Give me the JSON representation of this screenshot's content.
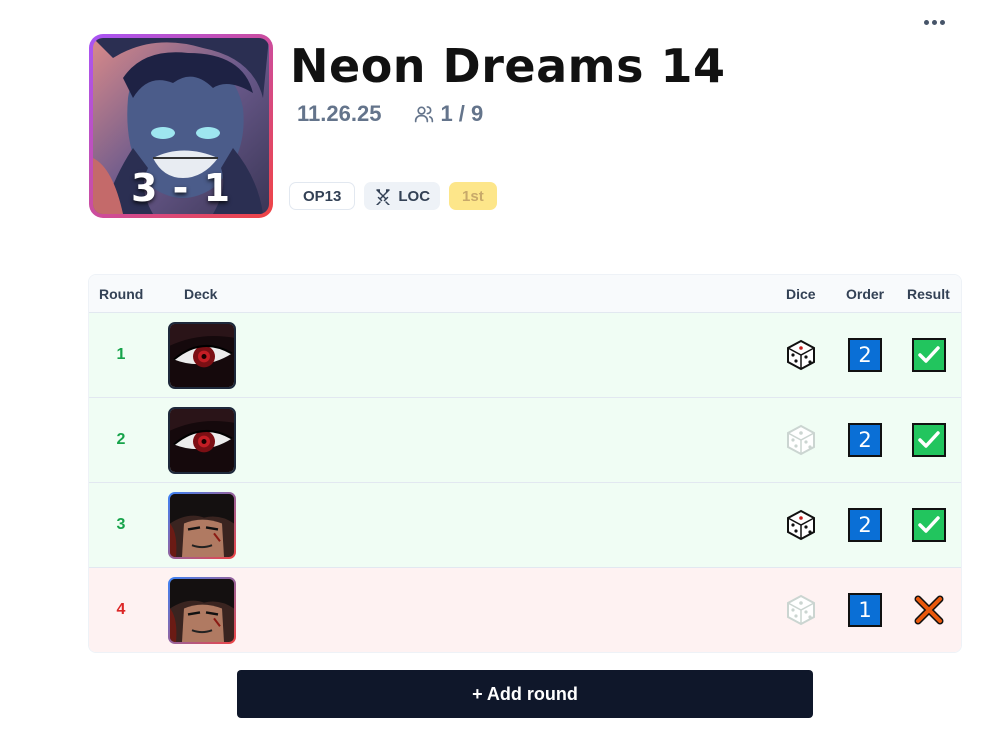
{
  "event": {
    "title": "Neon Dreams 14",
    "date": "11.26.25",
    "players": "1 / 9",
    "score": "3 - 1",
    "tags": {
      "set": "OP13",
      "format": "LOC",
      "placement": "1st"
    }
  },
  "icons": {
    "more": "more-horizontal-icon",
    "players": "users-icon",
    "format": "crossed-swords-icon",
    "dice": "dice-icon",
    "win": "check-mark-icon",
    "loss": "cross-mark-icon"
  },
  "table": {
    "headers": {
      "round": "Round",
      "deck": "Deck",
      "dice": "Dice",
      "order": "Order",
      "result": "Result"
    },
    "rows": [
      {
        "round": "1",
        "deck": "red-eye",
        "dice_won": true,
        "order": "2",
        "result": "win"
      },
      {
        "round": "2",
        "deck": "red-eye",
        "dice_won": false,
        "order": "2",
        "result": "win"
      },
      {
        "round": "3",
        "deck": "dark-hair",
        "dice_won": true,
        "order": "2",
        "result": "win"
      },
      {
        "round": "4",
        "deck": "dark-hair",
        "dice_won": false,
        "order": "1",
        "result": "loss"
      }
    ]
  },
  "actions": {
    "add_round": "+ Add round"
  },
  "colors": {
    "win_bg": "#f0fdf4",
    "loss_bg": "#fef2f2",
    "order_blue": "#0a6fd6",
    "check_green": "#22c55e",
    "cross_red": "#ea580c"
  }
}
